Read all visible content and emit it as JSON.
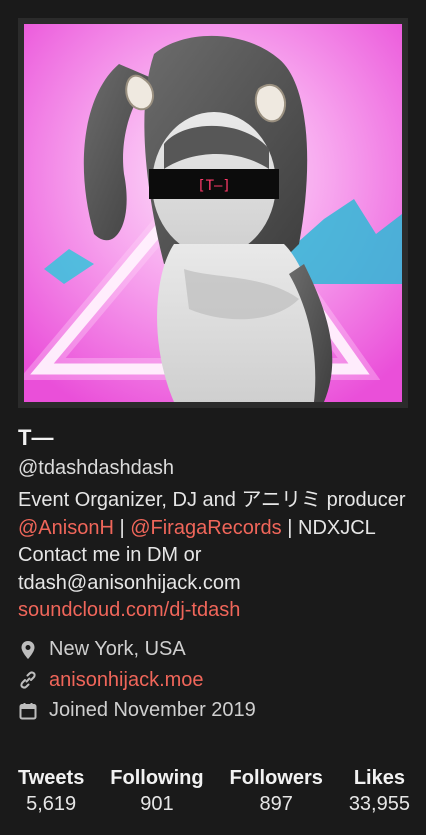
{
  "profile": {
    "display_name": "T—",
    "handle": "@tdashdashdash",
    "bio": {
      "line1": "Event Organizer, DJ and アニリミ producer",
      "link_anisonh": "@AnisonH",
      "sep1": " | ",
      "link_firaga": "@FiragaRecords",
      "sep2": " | NDXJCL",
      "contact": "Contact me in DM or tdash@anisonhijack.com",
      "soundcloud": "soundcloud.com/dj-tdash"
    },
    "location": "New York, USA",
    "website": "anisonhijack.moe",
    "joined": "Joined November 2019"
  },
  "stats": [
    {
      "label": "Tweets",
      "value": "5,619"
    },
    {
      "label": "Following",
      "value": "901"
    },
    {
      "label": "Followers",
      "value": "897"
    },
    {
      "label": "Likes",
      "value": "33,955"
    }
  ],
  "colors": {
    "background": "#1a1a1a",
    "link": "#f0665a",
    "avatar_pink": "#f06fe0",
    "avatar_cyan": "#3fd6e8"
  },
  "icons": {
    "location": "map-pin-icon",
    "website": "link-icon",
    "joined": "calendar-icon"
  }
}
